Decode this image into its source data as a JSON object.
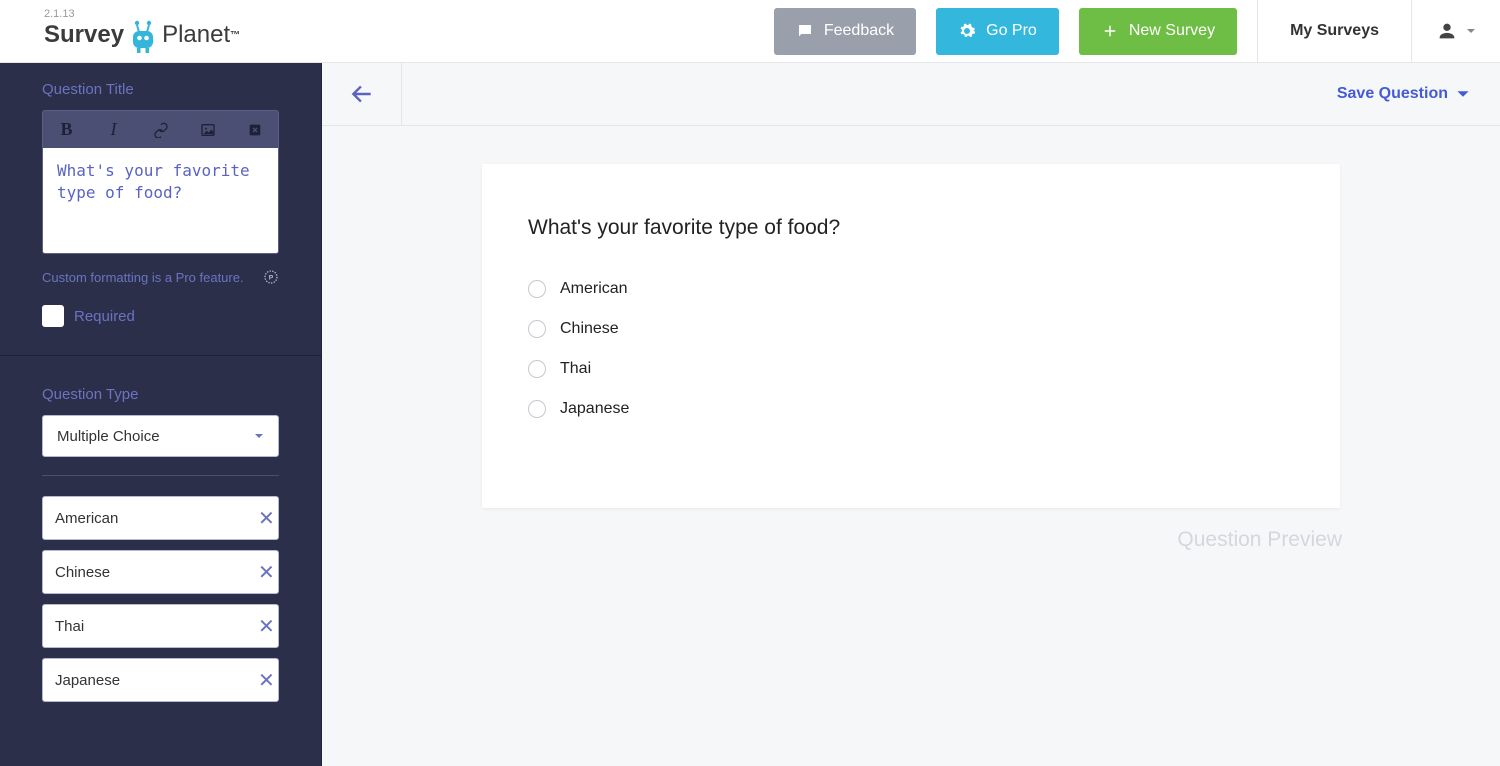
{
  "version": "2.1.13",
  "logo": {
    "word1": "Survey",
    "word2": "Planet"
  },
  "header": {
    "feedback": "Feedback",
    "gopro": "Go Pro",
    "newsurvey": "New Survey",
    "mysurveys": "My Surveys"
  },
  "sidebar": {
    "question_title_label": "Question Title",
    "question_title_value": "What's your favorite type of food?",
    "pro_note": "Custom formatting is a Pro feature.",
    "required_label": "Required",
    "question_type_label": "Question Type",
    "question_type_value": "Multiple Choice",
    "choices": [
      "American",
      "Chinese",
      "Thai",
      "Japanese"
    ]
  },
  "main": {
    "save_label": "Save Question",
    "preview_title": "What's your favorite type of food?",
    "options": [
      "American",
      "Chinese",
      "Thai",
      "Japanese"
    ],
    "preview_label": "Question Preview"
  }
}
